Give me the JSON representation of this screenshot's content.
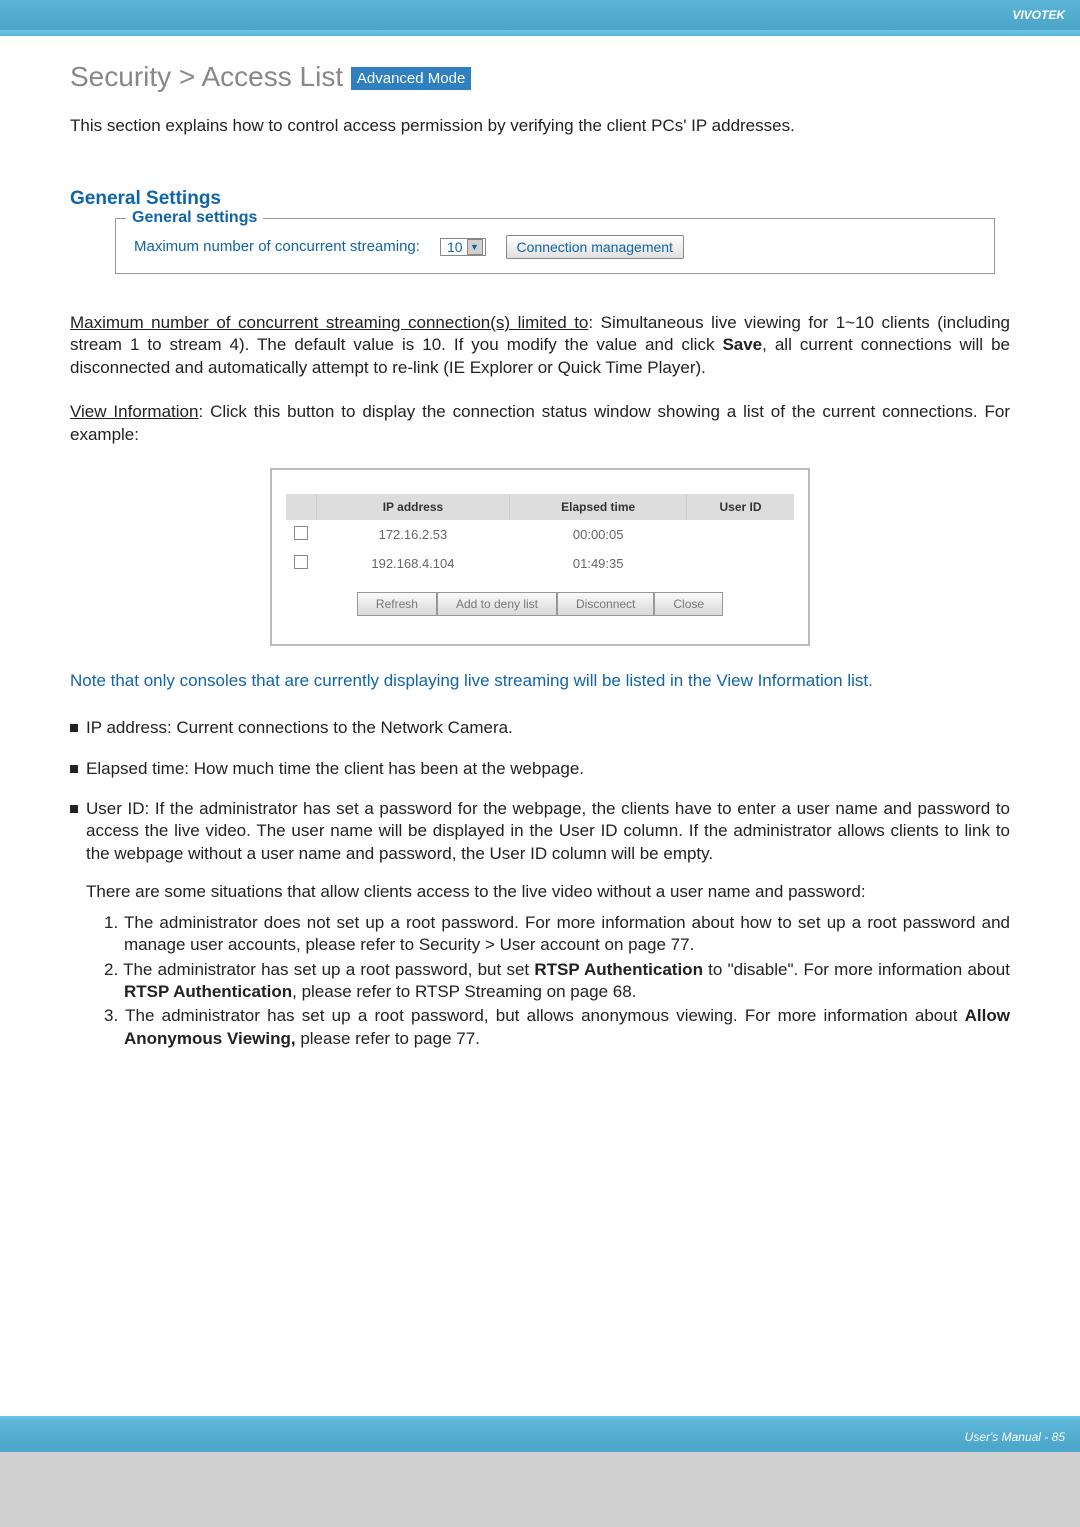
{
  "header": {
    "brand": "VIVOTEK"
  },
  "title": {
    "prefix": "Security >  Access List",
    "badge": "Advanced Mode"
  },
  "intro": "This section explains how to control access permission by verifying the client PCs' IP addresses.",
  "generalSettings": {
    "heading": "General Settings",
    "legend": "General settings",
    "label": "Maximum number of concurrent streaming:",
    "value": "10",
    "buttonLabel": "Connection management"
  },
  "para1": {
    "underlined": "Maximum number of concurrent streaming connection(s) limited to",
    "rest": ": Simultaneous live viewing for 1~10 clients (including stream 1 to stream 4). The default value is 10. If you modify the value and click ",
    "bold": "Save",
    "end": ", all current connections will be disconnected and automatically attempt to re-link (IE Explorer or Quick Time Player)."
  },
  "para2": {
    "underlined": "View Information",
    "rest": ": Click this button to display the connection status window showing a list of the current connections. For example:"
  },
  "connTable": {
    "headers": [
      "",
      "IP address",
      "Elapsed time",
      "User ID"
    ],
    "rows": [
      {
        "ip": "172.16.2.53",
        "elapsed": "00:00:05",
        "user": ""
      },
      {
        "ip": "192.168.4.104",
        "elapsed": "01:49:35",
        "user": ""
      }
    ],
    "buttons": [
      "Refresh",
      "Add to deny list",
      "Disconnect",
      "Close"
    ]
  },
  "note": "Note that only consoles that are currently displaying live streaming will be listed in the View Information list.",
  "bullets": {
    "b1": "IP address: Current connections to the Network Camera.",
    "b2": "Elapsed time: How much time the client has been at the webpage.",
    "b3": {
      "main": "User ID: If the administrator has set a password for the webpage, the clients have to enter a user name and password to access the live video. The user name will be displayed in the User ID column. If  the administrator allows clients to link to the webpage without a user name and password, the User ID column will be empty.",
      "sub": "There are some situations that allow clients access to the live video without a user name and password:",
      "n1": "1. The administrator does not set up a root password. For more information about how to set up a root password and manage user accounts, please refer to Security > User account on page 77.",
      "n2_pre": "2. The administrator has set up a root password, but set ",
      "n2_b1": "RTSP Authentication",
      "n2_mid": " to \"disable\". For more information about ",
      "n2_b2": "RTSP Authentication",
      "n2_end": ", please refer to RTSP Streaming on page 68.",
      "n3_pre": "3. The administrator has set up a root password, but allows anonymous viewing. For more information about ",
      "n3_b": "Allow Anonymous Viewing,",
      "n3_end": " please refer to page 77."
    }
  },
  "footer": {
    "text": "User's Manual - 85"
  }
}
